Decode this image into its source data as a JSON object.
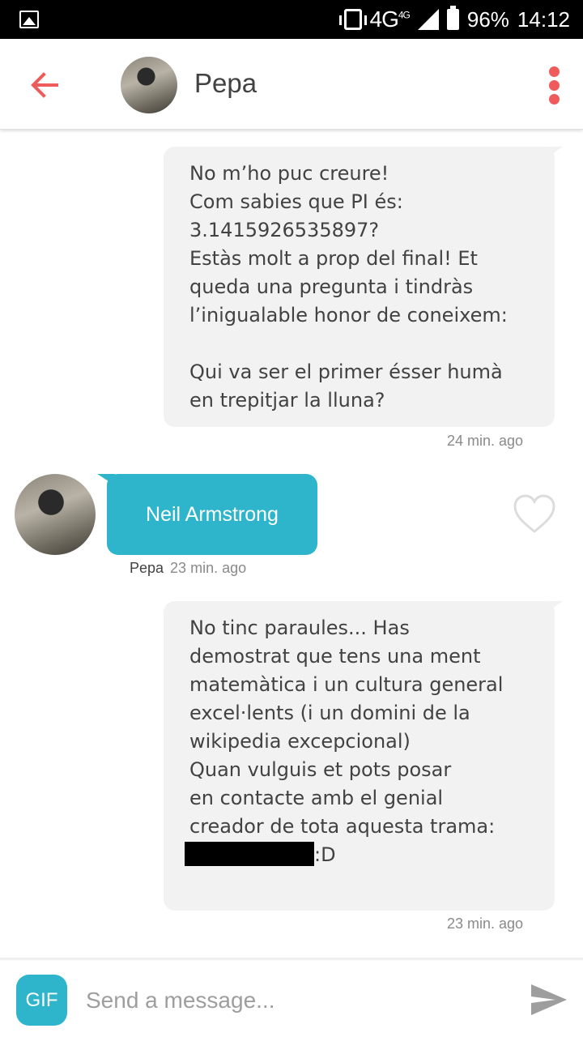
{
  "status_bar": {
    "network": "4G",
    "network_sup": "4G",
    "battery": "96%",
    "time": "14:12"
  },
  "header": {
    "contact_name": "Pepa"
  },
  "messages": [
    {
      "direction": "outgoing",
      "lines": [
        "No m’ho puc creure!",
        "Com sabies que PI és:",
        "3.1415926535897?",
        "Estàs molt a prop del final! Et",
        "queda una pregunta i tindràs",
        "l’inigualable honor de coneixem:",
        "",
        "Qui va ser el primer ésser humà",
        "en trepitjar la lluna?"
      ],
      "time": "24 min. ago"
    },
    {
      "direction": "incoming",
      "text": "Neil Armstrong",
      "sender": "Pepa",
      "time": "23 min. ago"
    },
    {
      "direction": "outgoing",
      "lines": [
        "No tinc paraules... Has",
        "demostrat que tens una ment",
        "matemàtica i un cultura general",
        "excel·lents (i un domini de la",
        "wikipedia excepcional)",
        "Quan vulguis et pots posar",
        "en contacte amb el genial",
        "creador de tota aquesta trama:"
      ],
      "last_line_suffix": ":D",
      "time": "23 min. ago"
    }
  ],
  "input_bar": {
    "gif_label": "GIF",
    "placeholder": "Send a message..."
  },
  "colors": {
    "accent": "#ef5b5b",
    "incoming_bubble": "#2fb5cb",
    "outgoing_bubble": "#f2f2f2"
  },
  "icons": [
    "gallery-icon",
    "vibrate-icon",
    "signal-icon",
    "battery-icon",
    "back-arrow-icon",
    "more-vert-icon",
    "heart-icon",
    "send-icon"
  ]
}
